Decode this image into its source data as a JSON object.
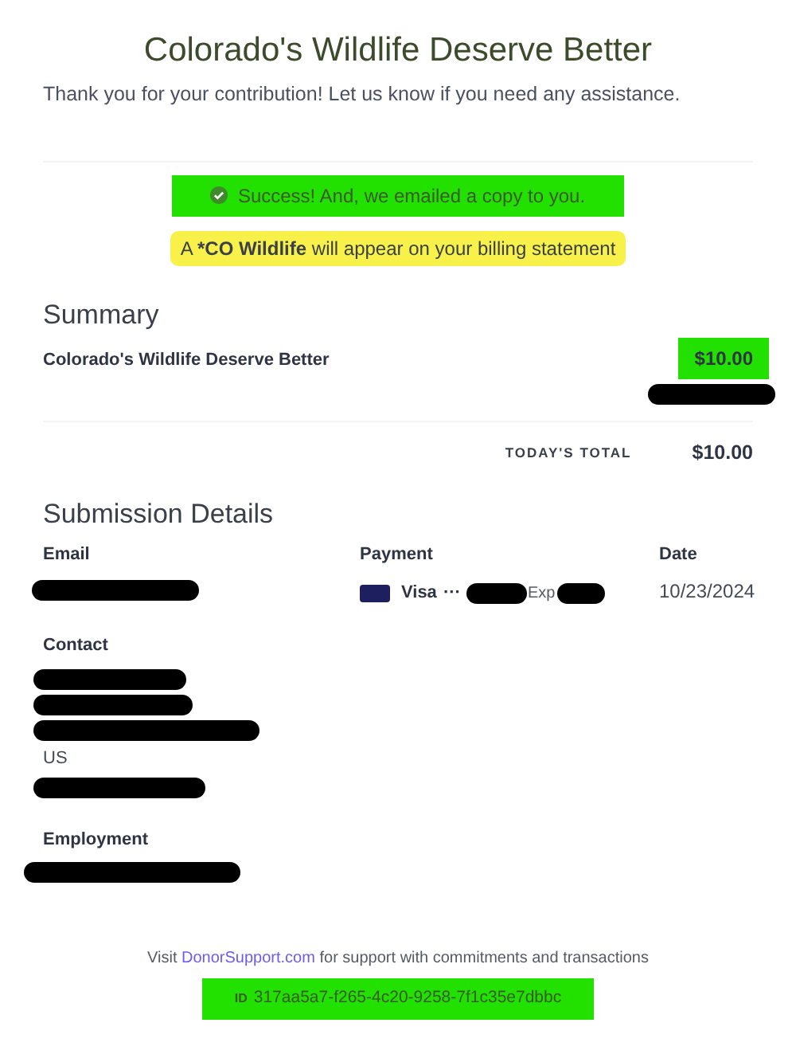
{
  "header": {
    "title": "Colorado's Wildlife Deserve Better",
    "subtitle": "Thank you for your contribution! Let us know if you need any assistance."
  },
  "success_banner": {
    "text": "Success! And, we emailed a copy to you.",
    "highlighted": true
  },
  "billing_note": {
    "prefix": "A",
    "emphasis": "*CO Wildlife",
    "suffix": "will appear on your billing statement"
  },
  "summary": {
    "heading": "Summary",
    "items": [
      {
        "name": "Colorado's Wildlife Deserve Better",
        "amount": "$10.00",
        "highlighted": true,
        "redacted_below": true
      }
    ],
    "total_label": "TODAY'S TOTAL",
    "total": "$10.00"
  },
  "submission_details": {
    "heading": "Submission Details",
    "email": {
      "label": "Email",
      "redacted": true
    },
    "payment": {
      "label": "Payment",
      "brand": "Visa",
      "dots": "···",
      "redacted": true,
      "exp_label": "Exp"
    },
    "date": {
      "label": "Date",
      "value": "10/23/2024"
    },
    "contact": {
      "label": "Contact",
      "lines": [
        {
          "kind": "redacted"
        },
        {
          "kind": "redacted"
        },
        {
          "kind": "redacted"
        },
        {
          "kind": "text",
          "text": "US"
        },
        {
          "kind": "redacted"
        }
      ]
    },
    "employment": {
      "label": "Employment",
      "redacted": true
    }
  },
  "footer": {
    "prefix": "Visit",
    "link": "DonorSupport.com",
    "suffix": "for support with commitments and transactions",
    "id_label": "ID",
    "id_value": "317aa5a7-f265-4c20-9258-7f1c35e7dbbc",
    "id_highlighted": true
  }
}
